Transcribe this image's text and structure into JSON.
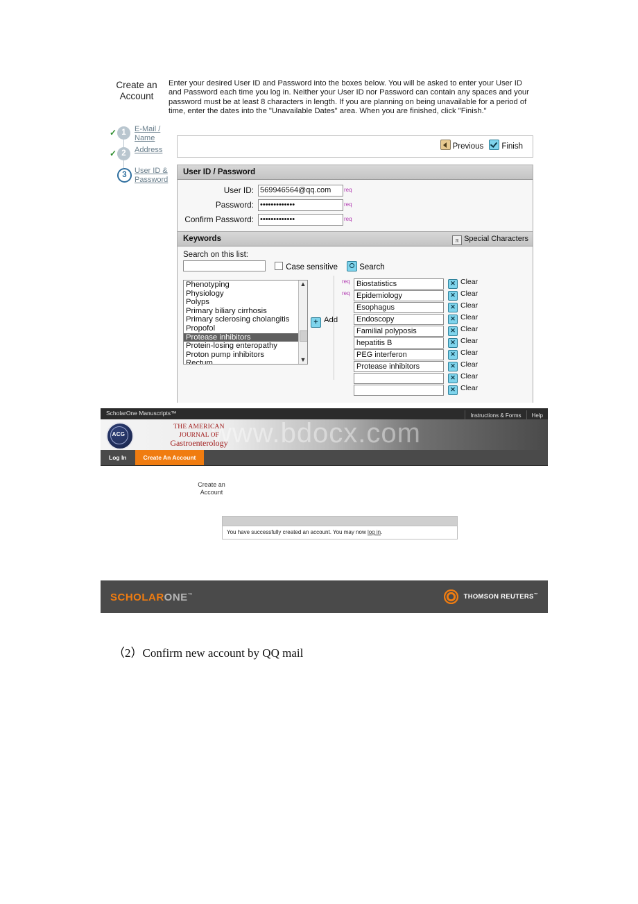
{
  "wizard": {
    "title": "Create an\nAccount",
    "title_line1": "Create an",
    "title_line2": "Account",
    "intro": "Enter your desired User ID and Password into the boxes below. You will be asked to enter your User ID and Password each time you log in. Neither your User ID nor Password can contain any spaces and your password must be at least 8 characters in length. If you are planning on being unavailable for a period of time, enter the dates into the \"Unavailable Dates\" area. When you are finished, click \"Finish.\"",
    "steps": [
      {
        "number": "1",
        "label": "E-Mail / Name",
        "state": "complete",
        "check": "✓"
      },
      {
        "number": "2",
        "label": "Address",
        "state": "complete",
        "check": "✓"
      },
      {
        "number": "3",
        "label": "User ID & Password",
        "state": "active",
        "check": ""
      }
    ],
    "nav": {
      "previous_label": "Previous",
      "finish_label": "Finish",
      "previous_icon": "left-arrow-icon",
      "finish_icon": "checkmark-icon"
    },
    "userid_section": {
      "header": "User ID / Password",
      "required_marker": "req",
      "fields": [
        {
          "label": "User ID:",
          "value": "569946564@qq.com",
          "required": "req"
        },
        {
          "label": "Password:",
          "value": "•••••••••••••",
          "required": "req"
        },
        {
          "label": "Confirm Password:",
          "value": "•••••••••••••",
          "required": "req"
        }
      ]
    },
    "keywords_section": {
      "header": "Keywords",
      "special_characters_label": "Special Characters",
      "special_characters_icon": "pi-icon",
      "search_label": "Search on this list:",
      "search_value": "",
      "case_sensitive_label": "Case sensitive",
      "case_sensitive_checked": false,
      "search_button_label": "Search",
      "search_button_icon": "magnifier-icon",
      "add_button_label": "Add",
      "add_button_icon": "plus-icon",
      "clear_label": "Clear",
      "clear_icon": "x-icon",
      "list_items": [
        {
          "text": "Phenotyping",
          "selected": false
        },
        {
          "text": "Physiology",
          "selected": false
        },
        {
          "text": "Polyps",
          "selected": false
        },
        {
          "text": "Primary biliary cirrhosis",
          "selected": false
        },
        {
          "text": "Primary sclerosing cholangitis",
          "selected": false
        },
        {
          "text": "Propofol",
          "selected": false
        },
        {
          "text": "Protease inhibitors",
          "selected": true
        },
        {
          "text": "Protein-losing enteropathy",
          "selected": false
        },
        {
          "text": "Proton pump inhibitors",
          "selected": false
        },
        {
          "text": "Rectum",
          "selected": false
        }
      ],
      "selected_keywords": [
        {
          "value": "Biostatistics",
          "required": "req"
        },
        {
          "value": "Epidemiology",
          "required": "req"
        },
        {
          "value": "Esophagus",
          "required": ""
        },
        {
          "value": "Endoscopy",
          "required": ""
        },
        {
          "value": "Familial polyposis",
          "required": ""
        },
        {
          "value": "hepatitis B",
          "required": ""
        },
        {
          "value": "PEG interferon",
          "required": ""
        },
        {
          "value": "Protease inhibitors",
          "required": ""
        },
        {
          "value": "",
          "required": ""
        },
        {
          "value": "",
          "required": ""
        }
      ]
    }
  },
  "scholarone": {
    "topbar": {
      "brand": "ScholarOne Manuscripts™",
      "links": [
        "Instructions & Forms",
        "Help"
      ]
    },
    "watermark": "www.bdocx.com",
    "journal": {
      "logo_text": "ACG",
      "line1": "THE AMERICAN",
      "line2": "JOURNAL OF",
      "line3": "Gastroenterology"
    },
    "tabs": [
      {
        "label": "Log In",
        "active": false
      },
      {
        "label": "Create An Account",
        "active": true
      }
    ],
    "page_title_line1": "Create an",
    "page_title_line2": "Account",
    "message": {
      "text_before": "You have successfully created an account. You may now ",
      "link": "log in",
      "text_after": "."
    },
    "footer": {
      "scholarone_a": "SCHOLAR",
      "scholarone_b": "ONE",
      "scholarone_tm": "™",
      "thomson": "THOMSON REUTERS",
      "thomson_tm": "™",
      "thomson_icon": "radial-dots-icon"
    }
  },
  "caption": {
    "text": "（2）Confirm new account by QQ mail"
  }
}
